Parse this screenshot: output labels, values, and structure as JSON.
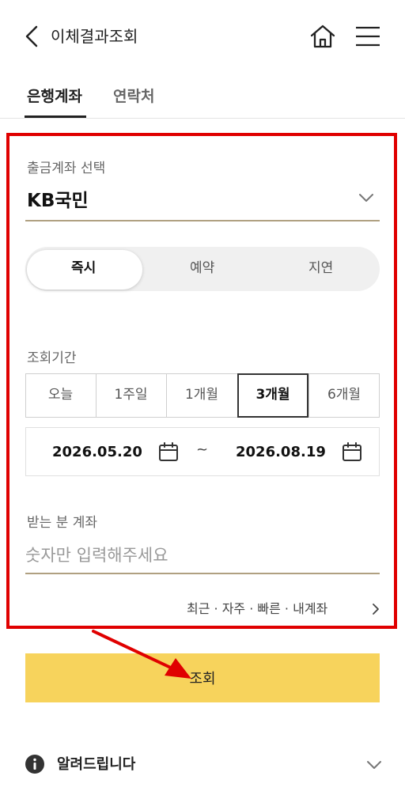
{
  "header": {
    "title": "이체결과조회"
  },
  "tabs": [
    {
      "label": "은행계좌",
      "active": true
    },
    {
      "label": "연락처",
      "active": false
    }
  ],
  "account": {
    "label": "출금계좌 선택",
    "value": "KB국민"
  },
  "mode": {
    "options": [
      "즉시",
      "예약",
      "지연"
    ],
    "selected": "즉시"
  },
  "period": {
    "label": "조회기간",
    "options": [
      "오늘",
      "1주일",
      "1개월",
      "3개월",
      "6개월"
    ],
    "selected": "3개월",
    "from": "2026.05.20",
    "separator": "~",
    "to": "2026.08.19"
  },
  "receiver": {
    "label": "받는 분 계좌",
    "placeholder": "숫자만 입력해주세요",
    "value": ""
  },
  "quick_link": "최근 · 자주 · 빠른 · 내계좌",
  "submit_label": "조회",
  "notice": {
    "label": "알려드립니다"
  },
  "colors": {
    "highlight_box": "#e00000",
    "submit_bg": "#f7d35c",
    "gold_underline": "#b0a081",
    "annotation_arrow": "#e00000"
  }
}
